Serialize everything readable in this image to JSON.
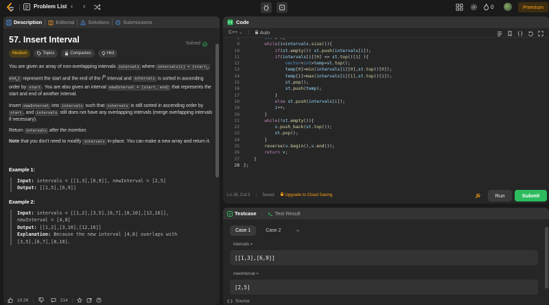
{
  "topbar": {
    "title": "Problem List",
    "prev": "‹",
    "next": "›",
    "streak_count": "0",
    "premium_label": "Premium"
  },
  "left_tabs": [
    "Description",
    "Editorial",
    "Solutions",
    "Submissions"
  ],
  "problem": {
    "title": "57. Insert Interval",
    "status": "Solved",
    "badges": [
      "Medium",
      "Topics",
      "Companies",
      "Hint"
    ],
    "p1_a": "You are given an array of non-overlapping intervals ",
    "p1_code1": "intervals",
    "p1_b": " where ",
    "p1_code2": "intervals[i] = [start",
    "p1_code2_sub": "i",
    "p1_code2_mid": ", end",
    "p1_code2_end": "]",
    "p1_c": " represent the start and the end of the i",
    "p1_sup": "th",
    "p1_d": " interval and ",
    "p1_code3": "intervals",
    "p1_e": " is sorted in ascending order by ",
    "p1_code4": "start",
    "p1_f": ". You are also given an interval ",
    "p1_code5": "newInterval = [start, end]",
    "p1_g": " that represents the start and end of another interval.",
    "p2_a": "Insert ",
    "p2_code1": "newInterval",
    "p2_b": " into ",
    "p2_code2": "intervals",
    "p2_c": " such that ",
    "p2_code3": "intervals",
    "p2_d": " is still sorted in ascending order by ",
    "p2_code4": "start",
    "p2_e": ", and ",
    "p2_code5": "intervals",
    "p2_f": " still does not have any overlapping intervals (merge overlapping intervals if necessary).",
    "p3_a": "Return ",
    "p3_code": "intervals",
    "p3_b": " after the insertion.",
    "p4_bold": "Note",
    "p4_a": " that you don't need to modify ",
    "p4_code": "intervals",
    "p4_b": " in-place. You can make a new array and return it.",
    "ex1_title": "Example 1:",
    "ex1_input_label": "Input:",
    "ex1_input": " intervals = [[1,3],[6,9]], newInterval = [2,5]",
    "ex1_output_label": "Output:",
    "ex1_output": " [[1,5],[6,9]]",
    "ex2_title": "Example 2:",
    "ex2_input_label": "Input:",
    "ex2_input": " intervals = [[1,2],[3,5],[6,7],[8,10],[12,16]],",
    "ex2_input2": "newInterval = [4,8]",
    "ex2_output_label": "Output:",
    "ex2_output": " [[1,2],[3,10],[12,16]]",
    "ex2_expl_label": "Explanation:",
    "ex2_expl": " Because the new interval [4,8] overlaps with",
    "ex2_expl2": "[3,5],[6,7],[8,10]."
  },
  "footer": {
    "likes": "10.2K",
    "comments": "214"
  },
  "code": {
    "tab_label": "Code",
    "language": "C++",
    "mode": "Auto",
    "line_numbers": [
      "8",
      "9",
      "10",
      "11",
      "12",
      "13",
      "14",
      "15",
      "16",
      "17",
      "18",
      "19",
      "20",
      "21",
      "22",
      "23",
      "24",
      "25",
      "26",
      "27",
      "28"
    ],
    "lines": [
      "        int i=0;",
      "        while(i<intervals.size()){",
      "            if(st.empty()) st.push(intervals[i]);",
      "            if(intervals[i][0] <= st.top()[1] ){",
      "                vector<int>temp=st.top();",
      "                temp[0]=min(intervals[i][0],st.top()[0]);",
      "                temp[1]=max(intervals[i][1],st.top()[1]);",
      "                st.pop();",
      "                st.push(temp);",
      "            }",
      "            else st.push(intervals[i]);",
      "            i++;",
      "        }",
      "        while(!st.empty()){",
      "            v.push_back(st.top());",
      "            st.pop();",
      "        }",
      "        reverse(v.begin(),v.end());",
      "        return v;",
      "    }",
      "};"
    ],
    "cursor": "Ln 28, Col 3",
    "saved": "Saved",
    "upgrade": "Upgrade to Cloud Saving",
    "run_label": "Run",
    "submit_label": "Submit"
  },
  "testcase": {
    "tab_testcase": "Testcase",
    "tab_result": "Test Result",
    "cases": [
      "Case 1",
      "Case 2"
    ],
    "add": "+",
    "label1": "intervals =",
    "value1": "[[1,3],[6,9]]",
    "label2": "newInterval =",
    "value2": "[2,5]",
    "source": "Source"
  },
  "colors": {
    "accent_orange": "#ffa116",
    "medium_yellow": "#ffc01e",
    "submit_green": "#2cbb5d",
    "tab_blue": "#4a9eff"
  }
}
